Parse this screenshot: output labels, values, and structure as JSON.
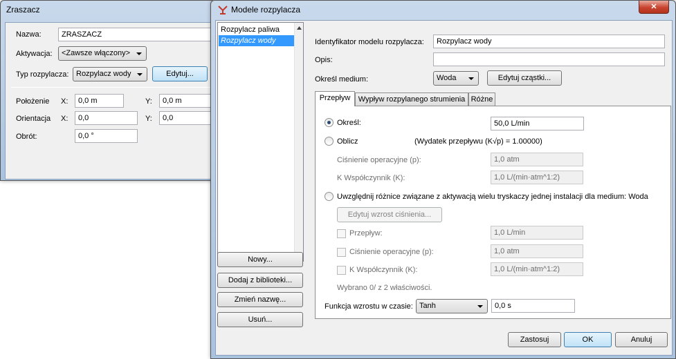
{
  "zraszacz": {
    "title": "Zraszacz",
    "name_label": "Nazwa:",
    "name_value": "ZRASZACZ",
    "activation_label": "Aktywacja:",
    "activation_value": "<Zawsze włączony>",
    "sprinkler_type_label": "Typ rozpylacza:",
    "sprinkler_type_value": "Rozpylacz wody",
    "edit_button": "Edytuj...",
    "position_label": "Położenie",
    "position_x_label": "X:",
    "position_x_value": "0,0 m",
    "position_y_label": "Y:",
    "position_y_value": "0,0 m",
    "orientation_label": "Orientacja",
    "orientation_x_label": "X:",
    "orientation_x_value": "0,0",
    "orientation_y_label": "Y:",
    "orientation_y_value": "0,0",
    "rotation_label": "Obrót:",
    "rotation_value": "0,0 °"
  },
  "models": {
    "title": "Modele rozpylacza",
    "list_items": [
      "Rozpylacz paliwa",
      "Rozpylacz wody"
    ],
    "selected_index": 1,
    "side_buttons": {
      "new": "Nowy...",
      "add_from_library": "Dodaj z biblioteki...",
      "rename": "Zmień nazwę...",
      "delete": "Usuń..."
    },
    "id_label": "Identyfikator modelu rozpylacza:",
    "id_value": "Rozpylacz wody",
    "description_label": "Opis:",
    "description_value": "",
    "medium_label": "Określ medium:",
    "medium_value": "Woda",
    "edit_particles_button": "Edytuj cząstki...",
    "tabs": [
      "Przepływ",
      "Wypływ rozpylanego strumienia",
      "Różne"
    ],
    "active_tab": 0,
    "flow": {
      "specify_label": "Określ:",
      "specify_value": "50,0 L/min",
      "calculate_label": "Oblicz",
      "k_factor_text": "(Wydatek przepływu (K√p) = 1.00000)",
      "operating_pressure_label": "Ciśnienie operacyjne (p):",
      "operating_pressure_value": "1,0 atm",
      "k_coefficient_label": "K Współczynnik (K):",
      "k_coefficient_value": "1,0 L/(min·atm^1:2)",
      "multi_label": "Uwzględnij różnice związane z aktywacją wielu tryskaczy jednej instalacji dla medium: Woda",
      "edit_pressure_rise_button": "Edytuj wzrost ciśnienia...",
      "chk_flow_label": "Przepływ:",
      "chk_flow_value": "1,0 L/min",
      "chk_pressure_label": "Ciśnienie operacyjne (p):",
      "chk_pressure_value": "1,0 atm",
      "chk_k_label": "K Współczynnik (K):",
      "chk_k_value": "1,0 L/(min·atm^1:2)",
      "selected_count_text": "Wybrano 0/ z 2 właściwości.",
      "growth_function_label": "Funkcja wzrostu w czasie:",
      "growth_function_value": "Tanh",
      "growth_time_value": "0,0 s"
    },
    "buttons": {
      "apply": "Zastosuj",
      "ok": "OK",
      "cancel": "Anuluj"
    },
    "close_glyph": "✕"
  },
  "colors": {
    "selection": "#3399ff",
    "close_button": "#c7442f",
    "title_icon": "#c0392b"
  }
}
